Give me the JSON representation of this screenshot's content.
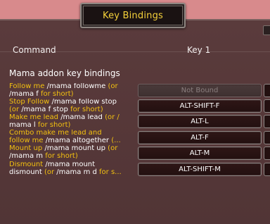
{
  "window": {
    "title": "Key Bindings"
  },
  "columns": {
    "command": "Command",
    "key1": "Key 1"
  },
  "section": {
    "title": "Mama addon key bindings"
  },
  "rows": [
    {
      "line1": [
        {
          "t": "Follow me ",
          "c": "y"
        },
        {
          "t": "/mama followme",
          "c": "w"
        },
        {
          "t": " (or",
          "c": "y"
        }
      ],
      "line2": [
        {
          "t": "/mama f ",
          "c": "w"
        },
        {
          "t": "for short)",
          "c": "y"
        }
      ],
      "key": "Not Bound",
      "bound": false
    },
    {
      "line1": [
        {
          "t": "Stop Follow ",
          "c": "y"
        },
        {
          "t": "/mama follow stop",
          "c": "w"
        }
      ],
      "line2": [
        {
          "t": "(or ",
          "c": "y"
        },
        {
          "t": "/mama f stop ",
          "c": "w"
        },
        {
          "t": "for short)",
          "c": "y"
        }
      ],
      "key": "ALT-SHIFT-F",
      "bound": true
    },
    {
      "line1": [
        {
          "t": "Make me lead ",
          "c": "y"
        },
        {
          "t": "/mama lead",
          "c": "w"
        },
        {
          "t": " (or /",
          "c": "y"
        }
      ],
      "line2": [
        {
          "t": "mama l ",
          "c": "w"
        },
        {
          "t": "for short)",
          "c": "y"
        }
      ],
      "key": "ALT-L",
      "bound": true
    },
    {
      "line1": [
        {
          "t": "Combo make me lead and",
          "c": "y"
        }
      ],
      "line2": [
        {
          "t": "follow me ",
          "c": "y"
        },
        {
          "t": "/mama altogether",
          "c": "w"
        },
        {
          "t": " (...",
          "c": "y"
        }
      ],
      "key": "ALT-F",
      "bound": true
    },
    {
      "line1": [
        {
          "t": "Mount up ",
          "c": "y"
        },
        {
          "t": "/mama mount up",
          "c": "w"
        },
        {
          "t": " (or",
          "c": "y"
        }
      ],
      "line2": [
        {
          "t": "/mama m ",
          "c": "w"
        },
        {
          "t": "for short)",
          "c": "y"
        }
      ],
      "key": "ALT-M",
      "bound": true
    },
    {
      "line1": [
        {
          "t": "Dismount ",
          "c": "y"
        },
        {
          "t": "/mama mount",
          "c": "w"
        }
      ],
      "line2": [
        {
          "t": "dismount",
          "c": "w"
        },
        {
          "t": " (or ",
          "c": "y"
        },
        {
          "t": "/mama m d",
          "c": "w"
        },
        {
          "t": " for s...",
          "c": "y"
        }
      ],
      "key": "ALT-SHIFT-M",
      "bound": true
    }
  ]
}
